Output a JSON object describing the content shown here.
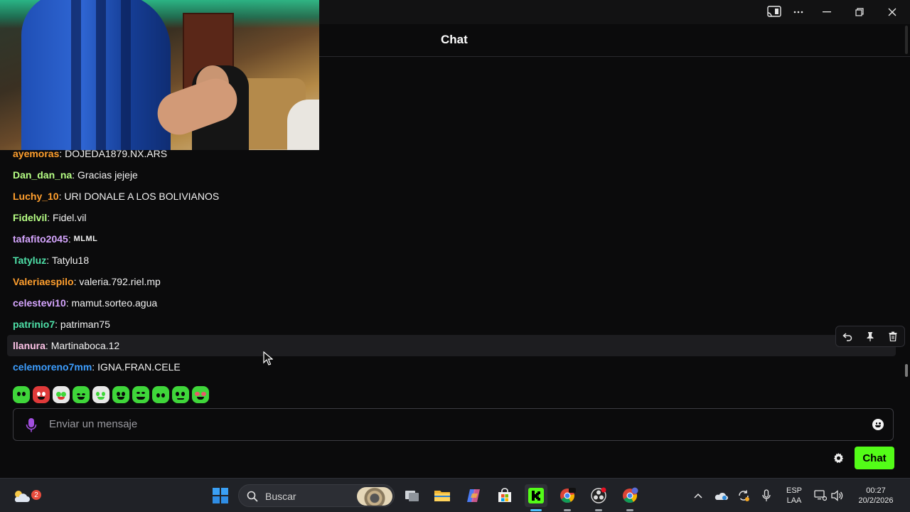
{
  "header": {
    "title": "Chat"
  },
  "messages": [
    {
      "user": "ayemoras",
      "color": "#ff9f2e",
      "text": "DOJEDA1879.NX.ARS"
    },
    {
      "user": "Dan_dan_na",
      "color": "#b7ff85",
      "text": "Gracias jejeje"
    },
    {
      "user": "Luchy_10",
      "color": "#ff9f2e",
      "text": "URI DONALE A LOS BOLIVIANOS"
    },
    {
      "user": "Fidelvil",
      "color": "#b7ff85",
      "text": "Fidel.vil"
    },
    {
      "user": "tafafito2045",
      "color": "#d6a6ff",
      "text": "MLML"
    },
    {
      "user": "Tatyluz",
      "color": "#4ee0a8",
      "text": "Tatylu18"
    },
    {
      "user": "Valeriaespilo",
      "color": "#ff9f2e",
      "text": "valeria.792.riel.mp"
    },
    {
      "user": "celestevi10",
      "color": "#d6a6ff",
      "text": "mamut.sorteo.agua"
    },
    {
      "user": "patrinio7",
      "color": "#4ee0a8",
      "text": "patriman75"
    },
    {
      "user": "llanura",
      "color": "#ffc4e8",
      "text": "Martinaboca.12"
    },
    {
      "user": "celemoreno7mm",
      "color": "#3d9eff",
      "text": "IGNA.FRAN.CELE"
    }
  ],
  "message_actions": [
    "reply-icon",
    "pin-icon",
    "delete-icon"
  ],
  "emotes": [
    {
      "name": "emote-1",
      "color": "#3fd63a"
    },
    {
      "name": "emote-2",
      "color": "#e03a3a"
    },
    {
      "name": "emote-3",
      "color": "#e8e8e8"
    },
    {
      "name": "emote-4",
      "color": "#3fd63a"
    },
    {
      "name": "emote-5",
      "color": "#e8e8e8"
    },
    {
      "name": "emote-6",
      "color": "#3fd63a"
    },
    {
      "name": "emote-7",
      "color": "#3fd63a"
    },
    {
      "name": "emote-8",
      "color": "#3fd63a"
    },
    {
      "name": "emote-9",
      "color": "#3fd63a"
    },
    {
      "name": "emote-10",
      "color": "#e85a6a"
    }
  ],
  "input": {
    "placeholder": "Enviar un mensaje"
  },
  "chat_button": "Chat",
  "accent": "#53fc18",
  "taskbar": {
    "weather_badge": "2",
    "search_placeholder": "Buscar",
    "language_top": "ESP",
    "language_bottom": "LAA",
    "time": "00:27",
    "date": "20/2/2026"
  }
}
